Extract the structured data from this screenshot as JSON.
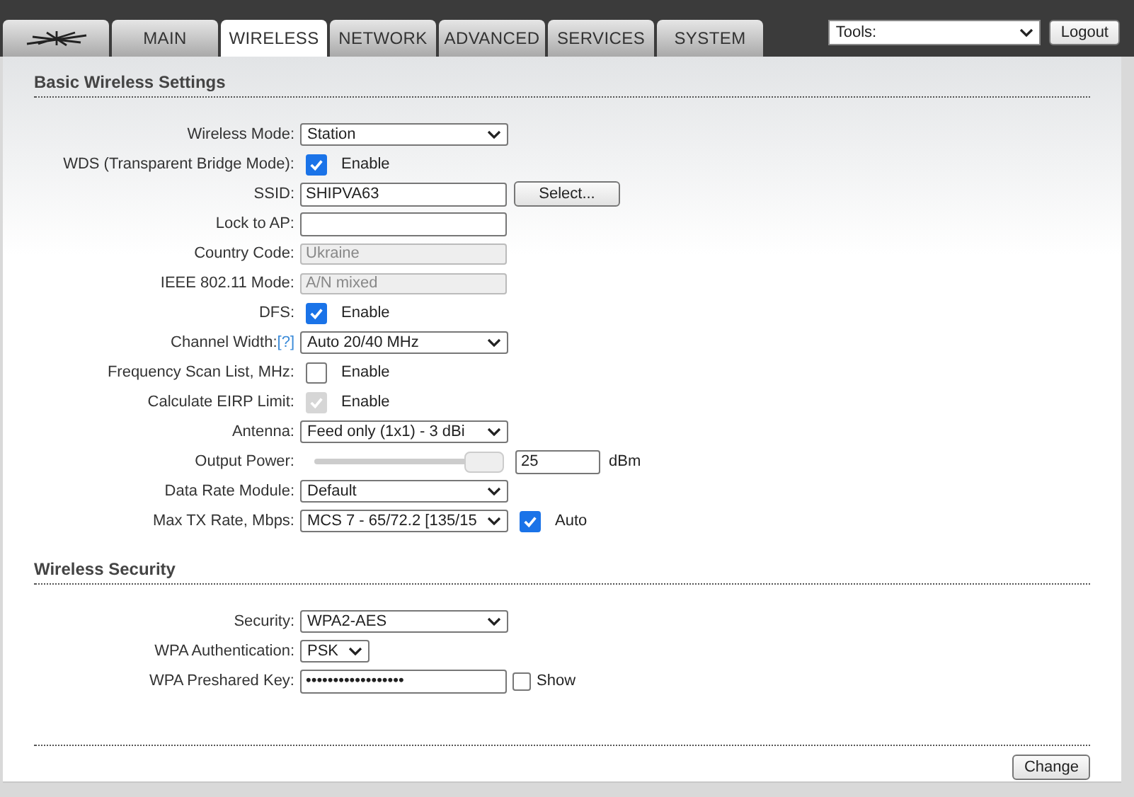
{
  "tabs": [
    {
      "kind": "logo",
      "selected": false
    },
    {
      "label": "MAIN",
      "selected": false
    },
    {
      "label": "WIRELESS",
      "selected": true
    },
    {
      "label": "NETWORK",
      "selected": false
    },
    {
      "label": "ADVANCED",
      "selected": false
    },
    {
      "label": "SERVICES",
      "selected": false
    },
    {
      "label": "SYSTEM",
      "selected": false
    }
  ],
  "tools": {
    "value": "Tools:",
    "button": "Logout"
  },
  "sections": [
    {
      "title": "Basic Wireless Settings",
      "rows": [
        {
          "label": "Wireless Mode:",
          "kind": "select",
          "value": "Station"
        },
        {
          "label": "WDS (Transparent Bridge Mode):",
          "kind": "checkbox",
          "text": "Enable",
          "checked": true,
          "disabled": false
        },
        {
          "label": "SSID:",
          "kind": "text",
          "value": "SHIPVA63",
          "button": "Select..."
        },
        {
          "label": "Lock to AP:",
          "kind": "text",
          "value": ""
        },
        {
          "label": "Country Code:",
          "kind": "readonly",
          "value": "Ukraine"
        },
        {
          "label": "IEEE 802.11 Mode:",
          "kind": "readonly",
          "value": "A/N mixed"
        },
        {
          "label": "DFS:",
          "kind": "checkbox",
          "text": "Enable",
          "checked": true,
          "disabled": false
        },
        {
          "label": "Channel Width:",
          "help": "[?]",
          "kind": "select",
          "value": "Auto 20/40 MHz"
        },
        {
          "label": "Frequency Scan List, MHz:",
          "kind": "checkbox",
          "text": "Enable",
          "checked": false,
          "disabled": false
        },
        {
          "label": "Calculate EIRP Limit:",
          "kind": "checkbox",
          "text": "Enable",
          "checked": true,
          "disabled": true
        },
        {
          "label": "Antenna:",
          "kind": "select",
          "value": "Feed only (1x1) - 3 dBi"
        },
        {
          "label": "Output Power:",
          "kind": "slider",
          "level": 1,
          "value": "25",
          "unit": "dBm"
        },
        {
          "label": "Data Rate Module:",
          "kind": "select",
          "value": "Default"
        },
        {
          "label": "Max TX Rate, Mbps:",
          "kind": "select_check",
          "value": "MCS 7 - 65/72.2 [135/15",
          "text": "Auto",
          "checked": true
        }
      ]
    },
    {
      "title": "Wireless Security",
      "rows": [
        {
          "label": "Security:",
          "kind": "select",
          "value": "WPA2-AES"
        },
        {
          "label": "WPA Authentication:",
          "kind": "small_select",
          "value": "PSK"
        },
        {
          "label": "WPA Preshared Key:",
          "kind": "password",
          "value": "••••••••••••••••••",
          "text": "Show",
          "checked": false
        }
      ]
    }
  ],
  "action": "Change"
}
